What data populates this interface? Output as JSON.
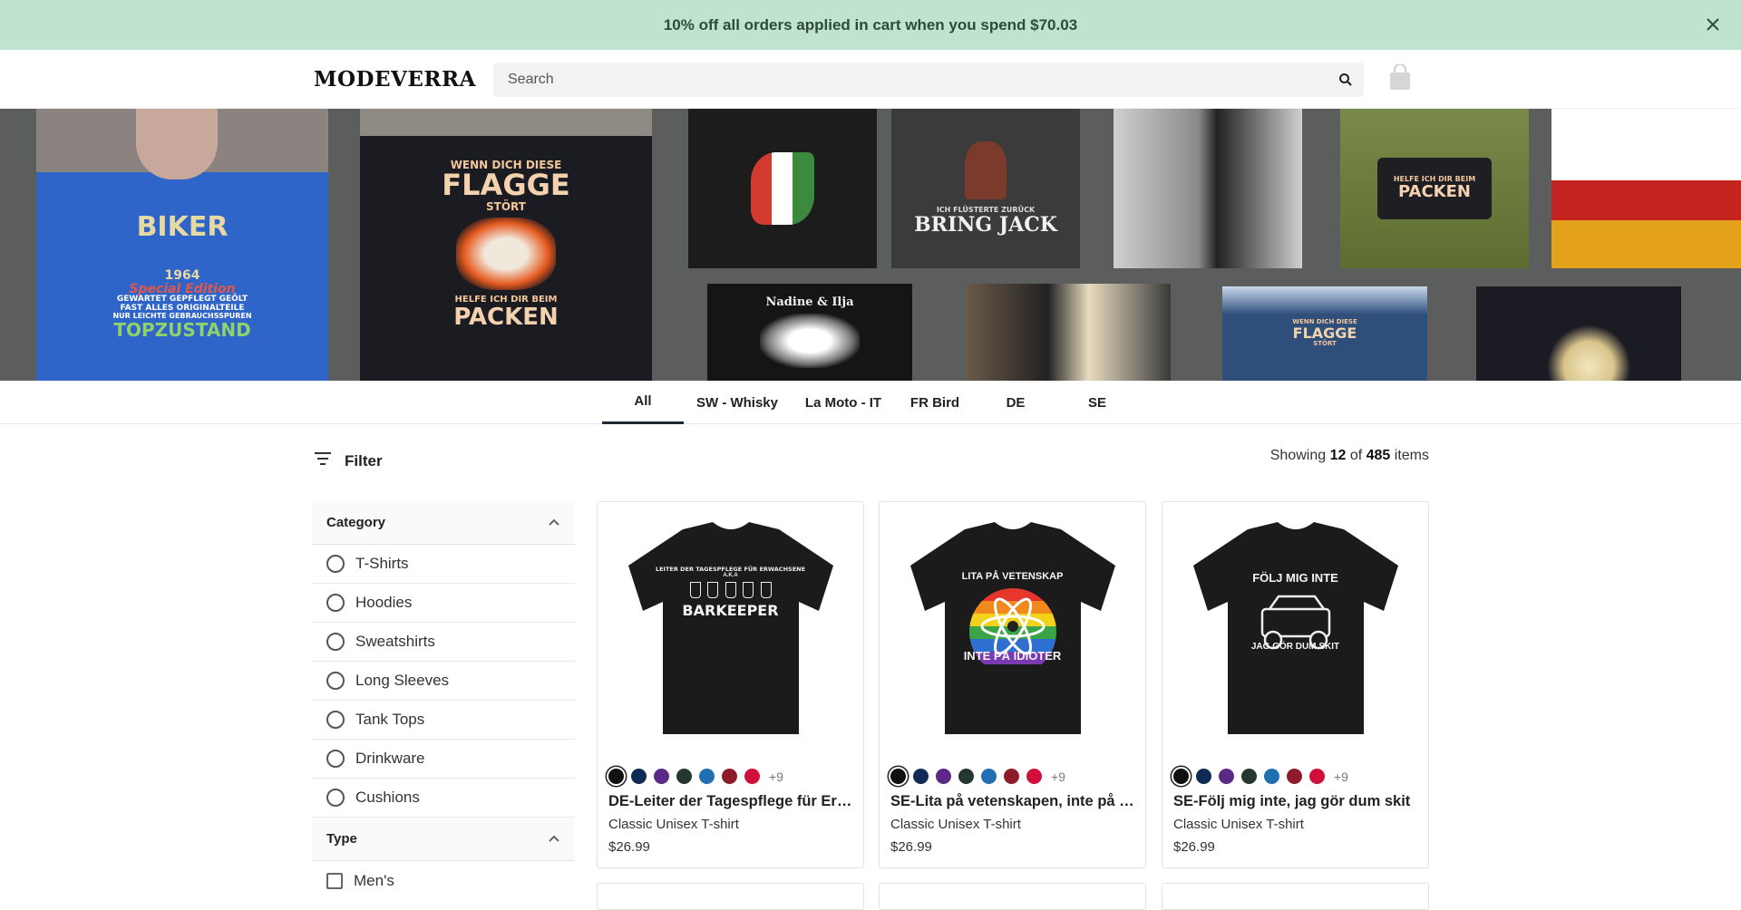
{
  "promo": {
    "text": "10% off all orders applied in cart when you spend $70.03"
  },
  "header": {
    "logo": "MODEVERRA",
    "search_placeholder": "Search"
  },
  "hero": {
    "tiles": [
      {
        "lines": [
          "BIKER",
          "1964",
          "Special Edition",
          "GEWARTET GEPFLEGT GEÖLT",
          "FAST ALLES ORIGINALTEILE",
          "NUR LEICHTE GEBRAUCHSSPUREN",
          "TOPZUSTAND"
        ]
      },
      {
        "lines": [
          "WENN DICH DIESE",
          "FLAGGE",
          "STÖRT",
          "HELFE ICH DIR BEIM",
          "PACKEN"
        ]
      },
      {
        "lines": [
          "ICH FLÜSTERTE ZURÜCK",
          "BRING JACK"
        ]
      },
      {
        "lines": [
          "HELFE ICH DIR BEIM",
          "PACKEN"
        ]
      },
      {
        "lines": [
          "Nadine & Ilja"
        ]
      },
      {
        "lines": [
          "WENN DICH DIESE",
          "FLAGGE",
          "STÖRT"
        ]
      }
    ]
  },
  "tabs": [
    "All",
    "SW - Whisky",
    "La Moto - IT",
    "FR Bird",
    "DE",
    "SE"
  ],
  "toolbar": {
    "filter_label": "Filter",
    "showing_prefix": "Showing",
    "showing_count": "12",
    "showing_of": "of",
    "showing_total": "485",
    "showing_suffix": "items"
  },
  "sidebar": {
    "category_title": "Category",
    "categories": [
      "T-Shirts",
      "Hoodies",
      "Sweatshirts",
      "Long Sleeves",
      "Tank Tops",
      "Drinkware",
      "Cushions"
    ],
    "type_title": "Type",
    "types": [
      "Men's"
    ]
  },
  "swatch_colors": [
    "#111111",
    "#0f2a55",
    "#5b2a86",
    "#24382f",
    "#1f6fb2",
    "#8e1b2a",
    "#d0103a"
  ],
  "products": [
    {
      "title": "DE-Leiter der Tagespflege für Erwachsene",
      "type": "Classic Unisex T-shirt",
      "price": "$26.99",
      "more_colors": "+9",
      "print_lines": [
        "LEITER DER TAGESPFLEGE FÜR ERWACHSENE",
        "A.K.A",
        "BARKEEPER"
      ]
    },
    {
      "title": "SE-Lita på vetenskapen, inte på idioter",
      "type": "Classic Unisex T-shirt",
      "price": "$26.99",
      "more_colors": "+9",
      "print_lines": [
        "LITA PÅ VETENSKAP",
        "INTE PÅ IDIOTER"
      ]
    },
    {
      "title": "SE-Följ mig inte, jag gör dum skit",
      "type": "Classic Unisex T-shirt",
      "price": "$26.99",
      "more_colors": "+9",
      "print_lines": [
        "FÖLJ MIG INTE",
        "JAG GÖR DUM SKIT"
      ]
    }
  ]
}
